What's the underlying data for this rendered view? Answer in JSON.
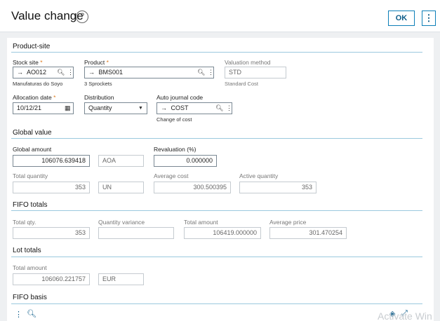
{
  "header": {
    "title": "Value change",
    "help_icon": "help-circle-icon",
    "ok_label": "OK",
    "more_label": "⋮"
  },
  "sections": {
    "product_site": "Product-site",
    "global_value": "Global value",
    "fifo_totals": "FIFO totals",
    "lot_totals": "Lot totals",
    "fifo_basis": "FIFO basis"
  },
  "product_site": {
    "stock_site": {
      "label": "Stock site",
      "required": "*",
      "value": "AO012",
      "sub": "Manufaturas do Soyo"
    },
    "product": {
      "label": "Product",
      "required": "*",
      "value": "BMS001",
      "sub": "3 Sprockets"
    },
    "valuation_method": {
      "label": "Valuation method",
      "value": "STD",
      "sub": "Standard Cost"
    },
    "allocation_date": {
      "label": "Allocation date",
      "required": "*",
      "value": "10/12/21"
    },
    "distribution": {
      "label": "Distribution",
      "value": "Quantity"
    },
    "auto_journal_code": {
      "label": "Auto journal code",
      "value": "COST",
      "sub": "Change of cost"
    }
  },
  "global_value": {
    "global_amount": {
      "label": "Global amount",
      "value": "106076.639418",
      "currency": "AOA"
    },
    "revaluation": {
      "label": "Revaluation (%)",
      "value": "0.000000"
    },
    "total_quantity": {
      "label": "Total quantity",
      "value": "353",
      "unit": "UN"
    },
    "average_cost": {
      "label": "Average cost",
      "value": "300.500395"
    },
    "active_quantity": {
      "label": "Active quantity",
      "value": "353"
    }
  },
  "fifo_totals": {
    "total_qty": {
      "label": "Total qty.",
      "value": "353"
    },
    "quantity_variance": {
      "label": "Quantity variance",
      "value": ""
    },
    "total_amount": {
      "label": "Total amount",
      "value": "106419.000000"
    },
    "average_price": {
      "label": "Average price",
      "value": "301.470254"
    }
  },
  "lot_totals": {
    "total_amount": {
      "label": "Total amount",
      "value": "106060.221757",
      "currency": "EUR"
    }
  },
  "watermark": "Activate Win"
}
